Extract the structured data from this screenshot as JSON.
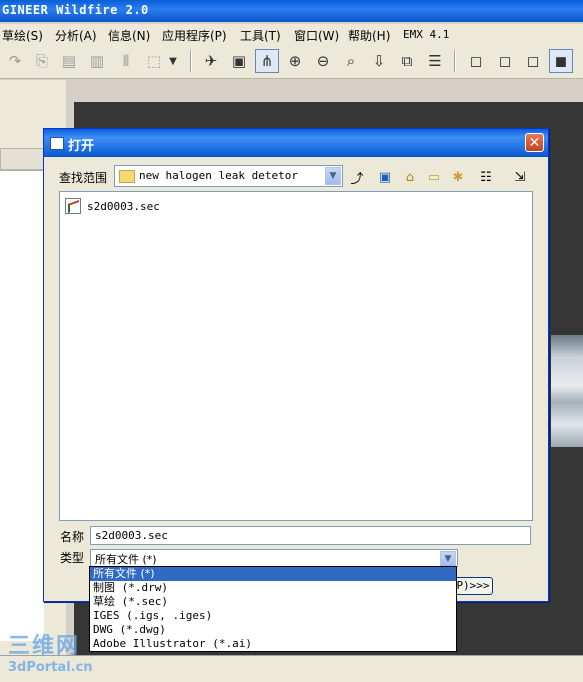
{
  "app": {
    "title": "GINEER Wildfire 2.0"
  },
  "menubar": {
    "items": [
      "草绘(S)",
      "分析(A)",
      "信息(N)",
      "应用程序(P)",
      "工具(T)",
      "窗口(W)",
      "帮助(H)",
      "EMX 4.1"
    ]
  },
  "toolbar": {
    "icons": [
      "redo-icon",
      "copy-icon",
      "paste-icon",
      "paste-special-icon",
      "mirror-icon",
      "select-box-icon",
      "dropdown-icon",
      "sketch-view-icon",
      "sketch-setup-icon",
      "datum-points-icon",
      "zoom-in-icon",
      "zoom-out-icon",
      "refit-icon",
      "reorient-icon",
      "view-list-icon",
      "layers-icon",
      "wireframe-icon",
      "hidden-line-icon",
      "no-hidden-icon",
      "shading-icon"
    ]
  },
  "dialog": {
    "title": "打开",
    "close_label": "✕",
    "lookin": {
      "label": "查找范围",
      "value": "new halogen leak detetor"
    },
    "nav_icons": [
      "up-folder-icon",
      "desktop-icon",
      "session-icon",
      "new-folder-icon",
      "working-dir-icon",
      "view-menu-icon",
      "tools-icon"
    ],
    "files": [
      {
        "name": "s2d0003.sec"
      }
    ],
    "name_field": {
      "label": "名称",
      "value": "s2d0003.sec"
    },
    "type_field": {
      "label": "类型",
      "value": "所有文件 (*)"
    },
    "type_options": [
      "所有文件 (*)",
      "制图 (*.drw)",
      "草绘 (*.sec)",
      "IGES (.igs, .iges)",
      "DWG (*.dwg)",
      "Adobe Illustrator (*.ai)"
    ],
    "selected_type_index": 0,
    "expand_label": "P)>>>"
  },
  "watermark": {
    "line1": "三维网",
    "line2": "3dPortal.cn"
  }
}
